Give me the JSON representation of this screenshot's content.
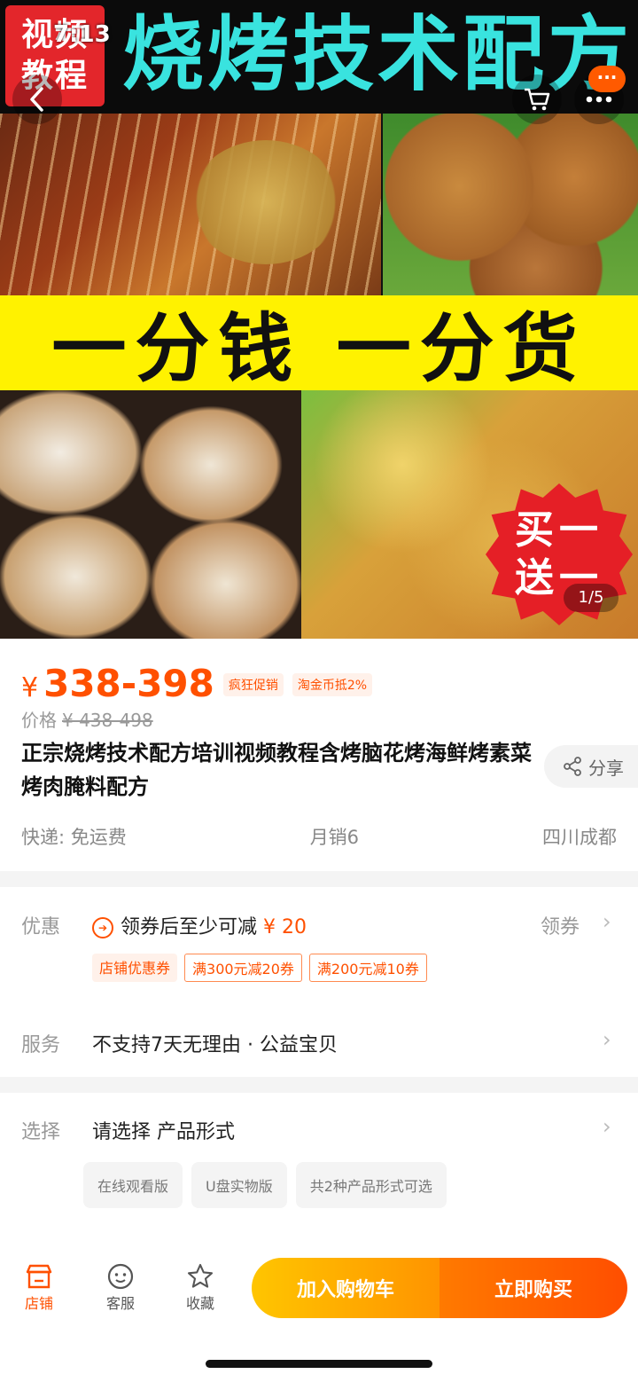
{
  "status": {
    "time": "7:13"
  },
  "hero": {
    "badge_line1": "视频",
    "badge_line2": "教程",
    "banner_title": "烧烤技术配方",
    "slogan": "一分钱 一分货",
    "promo_line1": "买一",
    "promo_line2": "送一",
    "page_indicator": "1/5",
    "more_badge": "···"
  },
  "product": {
    "currency": "¥",
    "price_range": "338-398",
    "tags": [
      "疯狂促销",
      "淘金币抵2%"
    ],
    "orig_label": "价格",
    "orig_price": "¥ 438-498",
    "title": "正宗烧烤技术配方培训视频教程含烤脑花烤海鲜烤素菜烤肉腌料配方",
    "share_label": "分享",
    "shipping": "快递: 免运费",
    "monthly_sales": "月销6",
    "location": "四川成都"
  },
  "offers": {
    "label": "优惠",
    "text": "领券后至少可减",
    "amount": "¥ 20",
    "action": "领券",
    "tags": [
      "店铺优惠券",
      "满300元减20券",
      "满200元减10券"
    ]
  },
  "service": {
    "label": "服务",
    "text": "不支持7天无理由 · 公益宝贝"
  },
  "selection": {
    "label": "选择",
    "text": "请选择 产品形式",
    "options": [
      "在线观看版",
      "U盘实物版",
      "共2种产品形式可选"
    ]
  },
  "bottom_bar": {
    "store": "店铺",
    "service": "客服",
    "favorite": "收藏",
    "add_cart": "加入购物车",
    "buy_now": "立即购买"
  },
  "colors": {
    "accent": "#ff5000",
    "cart_button": "#ffa000",
    "buy_button": "#ff5500"
  }
}
